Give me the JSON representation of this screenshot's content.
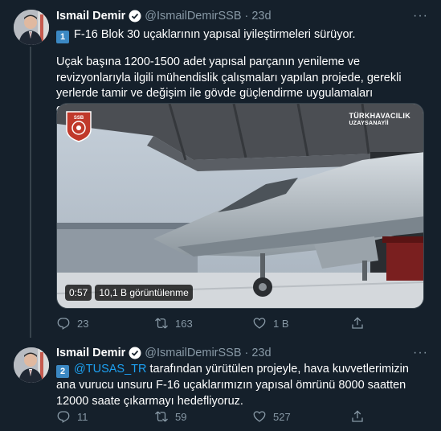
{
  "tweet1": {
    "name": "Ismail Demir",
    "handle": "@IsmailDemirSSB",
    "time": "23d",
    "num": "1",
    "title": "F-16 Blok 30 uçaklarının yapısal iyileştirmeleri sürüyor.",
    "paragraph": "Uçak başına 1200-1500 adet yapısal parçanın yenileme ve revizyonlarıyla ilgili mühendislik çalışmaları yapılan projede, gerekli yerlerde tamir ve değişim ile gövde güçlendirme uygulamaları gerçekleştiriliyor.",
    "video": {
      "duration": "0:57",
      "views": "10,1 B görüntülenme",
      "watermark_line1": "TÜRKHAVACILIK",
      "watermark_line2": "UZAYSANAYİİ",
      "logo_text": "SSB"
    },
    "replies": "23",
    "retweets": "163",
    "likes": "1 B"
  },
  "tweet2": {
    "name": "Ismail Demir",
    "handle": "@IsmailDemirSSB",
    "time": "23d",
    "num": "2",
    "mention": "@TUSAS_TR",
    "text": " tarafından yürütülen projeyle, hava kuvvetlerimizin ana vurucu unsuru F-16 uçaklarımızın yapısal ömrünü 8000 saatten 12000 saate çıkarmayı hedefliyoruz.",
    "replies": "11",
    "retweets": "59",
    "likes": "527"
  },
  "colors": {
    "background": "#15202b",
    "secondary_text": "#8899a6",
    "link": "#1da1f2",
    "divider": "#38444d"
  },
  "icons": [
    "more-icon",
    "verified-icon",
    "reply-icon",
    "retweet-icon",
    "like-icon",
    "share-icon"
  ]
}
